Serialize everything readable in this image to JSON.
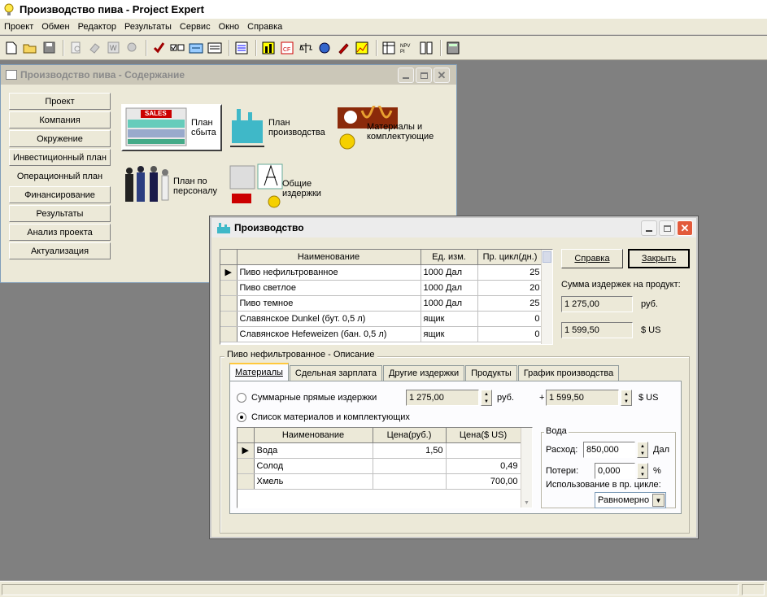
{
  "app": {
    "title": "Производство пива - Project Expert",
    "menu": [
      "Проект",
      "Обмен",
      "Редактор",
      "Результаты",
      "Сервис",
      "Окно",
      "Справка"
    ],
    "toolbar_icons": [
      "new-file-icon",
      "open-folder-icon",
      "save-icon",
      "print-preview-icon",
      "eraser-icon",
      "word-icon",
      "settings-icon",
      "check-icon",
      "checkboxes-icon",
      "calculate-icon",
      "report-icon",
      "list-icon",
      "chart-icon",
      "cashflow-icon",
      "scales-icon",
      "globe-icon",
      "pencil-icon",
      "graph-icon",
      "table-icon",
      "npv-pi-icon",
      "compare-icon",
      "calculator-icon"
    ]
  },
  "content_window": {
    "title": "Производство пива - Содержание",
    "nav": [
      "Проект",
      "Компания",
      "Окружение",
      "Инвестиционный план",
      "Операционный план",
      "Финансирование",
      "Результаты",
      "Анализ проекта",
      "Актуализация"
    ],
    "modules": {
      "sales": "План сбыта",
      "sales_badge": "SALES",
      "production": "План производства",
      "materials": "Материалы и комплектующие",
      "personnel": "План по персоналу",
      "overhead": "Общие издержки"
    }
  },
  "production_dialog": {
    "title": "Производство",
    "grid": {
      "headers": [
        "Наименование",
        "Ед. изм.",
        "Пр. цикл(дн.)"
      ],
      "rows": [
        {
          "name": "Пиво нефильтрованное",
          "unit": "1000 Дал",
          "cycle": "25"
        },
        {
          "name": "Пиво светлое",
          "unit": "1000 Дал",
          "cycle": "20"
        },
        {
          "name": "Пиво темное",
          "unit": "1000 Дал",
          "cycle": "25"
        },
        {
          "name": "Славянское Dunkel (бут. 0,5 л)",
          "unit": "ящик",
          "cycle": "0"
        },
        {
          "name": "Славянское Hefeweizen (бан. 0,5 л)",
          "unit": "ящик",
          "cycle": "0"
        }
      ]
    },
    "help_button": "Справка",
    "close_button": "Закрыть",
    "cost_label": "Сумма издержек на продукт:",
    "cost_rub": "1 275,00",
    "cost_rub_unit": "руб.",
    "cost_usd": "1 599,50",
    "cost_usd_unit": "$ US",
    "group_title": "Пиво нефильтрованное - Описание",
    "tabs": [
      "Материалы",
      "Сдельная зарплата",
      "Другие издержки",
      "Продукты",
      "График производства"
    ],
    "radio_total": "Суммарные прямые издержки",
    "total_rub": "1 275,00",
    "total_rub_unit": "руб.",
    "plus": "+",
    "total_usd": "1 599,50",
    "total_usd_unit": "$ US",
    "radio_list": "Список материалов и комплектующих",
    "materials": {
      "headers": [
        "Наименование",
        "Цена(руб.)",
        "Цена($ US)"
      ],
      "rows": [
        {
          "name": "Вода",
          "rub": "1,50",
          "usd": ""
        },
        {
          "name": "Солод",
          "rub": "",
          "usd": "0,49"
        },
        {
          "name": "Хмель",
          "rub": "",
          "usd": "700,00"
        }
      ]
    },
    "water": {
      "title": "Вода",
      "consumption_label": "Расход:",
      "consumption": "850,000",
      "consumption_unit": "Дал",
      "losses_label": "Потери:",
      "losses": "0,000",
      "losses_unit": "%",
      "usage_label": "Использование в пр. цикле:",
      "usage": "Равномерно"
    }
  }
}
